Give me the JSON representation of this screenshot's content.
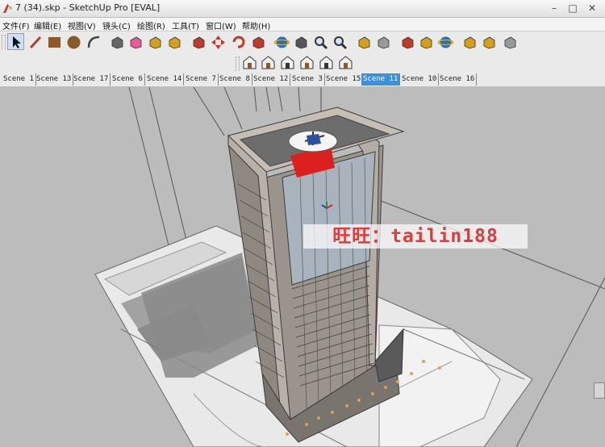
{
  "window": {
    "title": "7 (34).skp - SketchUp Pro [EVAL]",
    "minimize": "–",
    "maximize": "□",
    "close": "✕"
  },
  "menu": [
    "文件(F)",
    "编辑(E)",
    "视图(V)",
    "镜头(C)",
    "绘图(R)",
    "工具(T)",
    "窗口(W)",
    "帮助(H)"
  ],
  "toolbar_main": [
    {
      "name": "select-icon",
      "color": "#111111",
      "selected": true
    },
    {
      "name": "pencil-icon",
      "color": "#c0392b"
    },
    {
      "name": "rectangle-icon",
      "color": "#8b5a2b"
    },
    {
      "name": "circle-icon",
      "color": "#8b5a2b"
    },
    {
      "name": "arc-icon",
      "color": "#444444"
    },
    {
      "name": "make-component-icon",
      "color": "#666666"
    },
    {
      "name": "eraser-icon",
      "color": "#e85a9a"
    },
    {
      "name": "tape-measure-icon",
      "color": "#d4a017"
    },
    {
      "name": "paint-bucket-icon",
      "color": "#d4a017"
    },
    {
      "name": "push-pull-icon",
      "color": "#c0392b"
    },
    {
      "name": "move-icon",
      "color": "#c0392b"
    },
    {
      "name": "rotate-icon",
      "color": "#c0392b"
    },
    {
      "name": "follow-me-icon",
      "color": "#c0392b"
    },
    {
      "name": "orbit-icon",
      "color": "#2a6fb0"
    },
    {
      "name": "pan-icon",
      "color": "#555555"
    },
    {
      "name": "zoom-icon",
      "color": "#333333"
    },
    {
      "name": "zoom-extents-icon",
      "color": "#333333"
    },
    {
      "name": "add-location-icon",
      "color": "#d4a017"
    },
    {
      "name": "toggle-terrain-icon",
      "color": "#999999"
    },
    {
      "name": "get-models-icon",
      "color": "#c0392b"
    },
    {
      "name": "share-model-icon",
      "color": "#d4a017"
    },
    {
      "name": "google-earth-icon",
      "color": "#2a6fb0"
    },
    {
      "name": "get-components-icon",
      "color": "#d4a017"
    },
    {
      "name": "share-component-icon",
      "color": "#d4a017"
    },
    {
      "name": "extension-warehouse-icon",
      "color": "#999999"
    }
  ],
  "toolbar_views": [
    {
      "name": "iso-view-icon",
      "color": "#8b5a2b"
    },
    {
      "name": "top-view-icon",
      "color": "#8b5a2b"
    },
    {
      "name": "front-view-icon",
      "color": "#333333"
    },
    {
      "name": "right-view-icon",
      "color": "#8b5a2b"
    },
    {
      "name": "back-view-icon",
      "color": "#333333"
    },
    {
      "name": "left-view-icon",
      "color": "#8b5a2b"
    }
  ],
  "scenes": [
    "Scene 1",
    "Scene 13",
    "Scene 17",
    "Scene 6",
    "Scene 14",
    "Scene 7",
    "Scene 8",
    "Scene 12",
    "Scene 3",
    "Scene 15",
    "Scene 11",
    "Scene 10",
    "Scene 16"
  ],
  "active_scene": "Scene 11",
  "watermark": "旺旺：tailin188",
  "colors": {
    "sky": "#bcbcbc",
    "ground": "#e9e9e9",
    "tower": "#8f8880",
    "glass": "#a9b3bd",
    "helipad": "#dc2020",
    "watermark": "#e23a3a",
    "active_tab": "#3d8fd8"
  }
}
